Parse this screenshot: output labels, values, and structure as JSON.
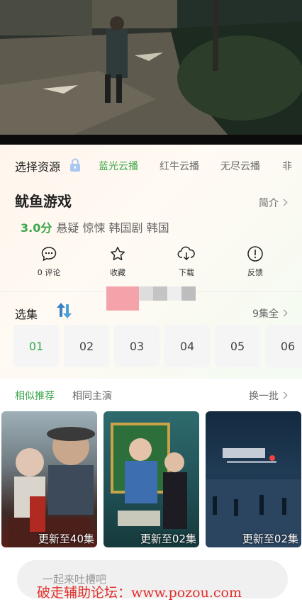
{
  "source": {
    "title": "选择资源",
    "tabs": [
      {
        "label": "蓝光云播",
        "active": true
      },
      {
        "label": "红牛云播",
        "active": false
      },
      {
        "label": "无尽云播",
        "active": false
      },
      {
        "label": "非",
        "active": false
      }
    ]
  },
  "show": {
    "title": "鱿鱼游戏",
    "intro_label": "简介",
    "score": "3.0分",
    "tags": "悬疑 惊悚 韩国剧 韩国"
  },
  "actions": [
    {
      "icon": "comment-icon",
      "label": "0 评论"
    },
    {
      "icon": "star-icon",
      "label": "收藏"
    },
    {
      "icon": "download-icon",
      "label": "下载"
    },
    {
      "icon": "feedback-icon",
      "label": "反馈"
    }
  ],
  "episodes": {
    "title": "选集",
    "count_label": "9集全",
    "items": [
      "01",
      "02",
      "03",
      "04",
      "05",
      "06"
    ],
    "active_index": 0
  },
  "recommend": {
    "tabs": [
      {
        "label": "相似推荐",
        "active": true
      },
      {
        "label": "相同主演",
        "active": false
      }
    ],
    "swap_label": "换一批",
    "posters": [
      {
        "caption": "更新至40集"
      },
      {
        "caption": "更新至02集"
      },
      {
        "caption": "更新至02集"
      }
    ]
  },
  "comment": {
    "placeholder": "一起来吐槽吧"
  },
  "watermark": "破走辅助论坛：www.pozou.com",
  "colors": {
    "accent": "#3aa64b",
    "watermark": "#e0302b"
  }
}
